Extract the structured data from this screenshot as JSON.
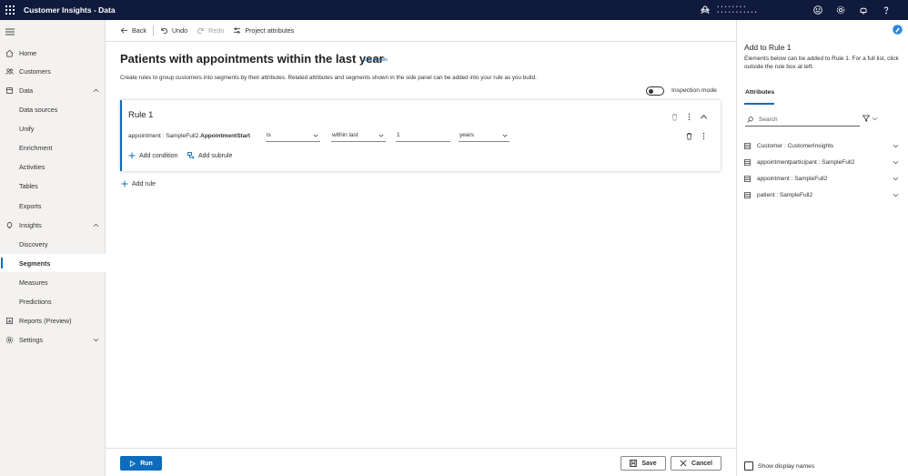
{
  "app": {
    "title": "Customer Insights - Data"
  },
  "topbar": {
    "env_line1": "• • • • • • • •",
    "env_line2": "• • •   • • • • • • • •"
  },
  "nav": {
    "items": [
      {
        "label": "Home"
      },
      {
        "label": "Customers"
      },
      {
        "label": "Data"
      },
      {
        "label": "Data sources"
      },
      {
        "label": "Unify"
      },
      {
        "label": "Enrichment"
      },
      {
        "label": "Activities"
      },
      {
        "label": "Tables"
      },
      {
        "label": "Exports"
      },
      {
        "label": "Insights"
      },
      {
        "label": "Discovery"
      },
      {
        "label": "Segments"
      },
      {
        "label": "Measures"
      },
      {
        "label": "Predictions"
      },
      {
        "label": "Reports (Preview)"
      },
      {
        "label": "Settings"
      }
    ]
  },
  "command_bar": {
    "back": "Back",
    "undo": "Undo",
    "redo": "Redo",
    "project_attributes": "Project attributes"
  },
  "main": {
    "title": "Patients with appointments within the last year",
    "edit_link": "Edit details",
    "description": "Create rules to group customers into segments by their attributes. Related attributes and segments shown in the side panel can be added into your rule as you build.",
    "inspection_mode": "Inspection mode",
    "rule": {
      "title": "Rule 1",
      "condition": {
        "field_prefix": "appointment : SampleFull2.",
        "field_name": "AppointmentStart",
        "operator": "is",
        "range": "within last",
        "value": "1",
        "unit": "years"
      },
      "add_condition": "Add condition",
      "add_subrule": "Add subrule"
    },
    "add_rule": "Add rule"
  },
  "footer": {
    "run": "Run",
    "save": "Save",
    "cancel": "Cancel"
  },
  "panel": {
    "title": "Add to Rule 1",
    "description": "Elements below can be added to Rule 1. For a full list, click outside the rule box at left.",
    "tab": "Attributes",
    "search_placeholder": "Search",
    "attributes": [
      {
        "label": "Customer : CustomerInsights"
      },
      {
        "label": "appointmentparticipant : SampleFull2"
      },
      {
        "label": "appointment : SampleFull2"
      },
      {
        "label": "patient : SampleFull2"
      }
    ],
    "show_display_names": "Show display names"
  },
  "colors": {
    "topbar": "#0f1a3d",
    "accent": "#0f6cbd"
  }
}
